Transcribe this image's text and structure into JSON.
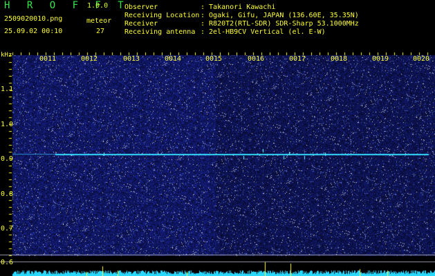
{
  "header": {
    "app_logo": "H R O F F T",
    "version": "1.0.0",
    "filename": "2509020010.png",
    "datetime": "25.09.02 00:10",
    "meteor_label": "meteor",
    "meteor_count": "27",
    "info": [
      {
        "label": "Observer",
        "value": ": Takanori Kawachi"
      },
      {
        "label": "Receiving Location",
        "value": ": Ogaki, Gifu, JAPAN (136.60E, 35.35N)"
      },
      {
        "label": "Receiver",
        "value": ": R820T2(RTL-SDR) SDR-Sharp 53.1000MHz"
      },
      {
        "label": "Receiving antenna",
        "value": ": 2el-HB9CV Vertical (el. E-W)"
      }
    ]
  },
  "axis": {
    "y_unit": "kHz",
    "y_ticks": [
      "1.1",
      "1.0",
      "0.9",
      "0.8",
      "0.7",
      "0.6"
    ],
    "x_ticks": [
      "0011",
      "0012",
      "0013",
      "0014",
      "0015",
      "0016",
      "0017",
      "0018",
      "0019",
      "0020"
    ]
  },
  "colors": {
    "text": "#ffff32",
    "logo": "#36e64a",
    "background": "#0a0f3c",
    "signal": "#33ddff"
  }
}
